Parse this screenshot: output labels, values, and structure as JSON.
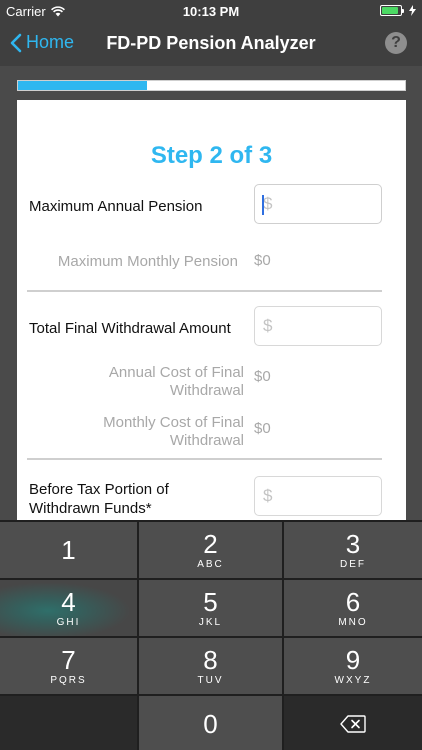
{
  "status_bar": {
    "carrier": "Carrier",
    "time": "10:13 PM",
    "battery_level": 0.9,
    "accent_color": "#4cd964"
  },
  "nav": {
    "back_label": "Home",
    "title": "FD-PD Pension Analyzer",
    "help_label": "?"
  },
  "progress": {
    "step": 2,
    "total": 3,
    "accent_color": "#2fb7f0"
  },
  "step_title": "Step 2 of 3",
  "form": {
    "max_annual_pension_label": "Maximum Annual Pension",
    "max_annual_pension_placeholder": "$",
    "max_monthly_pension_label": "Maximum Monthly Pension",
    "max_monthly_pension_value": "$0",
    "total_final_withdrawal_label": "Total Final Withdrawal Amount",
    "total_final_withdrawal_placeholder": "$",
    "annual_cost_label_line1": "Annual Cost of Final",
    "annual_cost_label_line2": "Withdrawal",
    "annual_cost_value": "$0",
    "monthly_cost_label_line1": "Monthly Cost of Final",
    "monthly_cost_label_line2": "Withdrawal",
    "monthly_cost_value": "$0",
    "before_tax_label_line1": "Before Tax Portion of",
    "before_tax_label_line2": "Withdrawn Funds*",
    "before_tax_placeholder": "$"
  },
  "keyboard": {
    "keys": [
      {
        "num": "1",
        "letters": ""
      },
      {
        "num": "2",
        "letters": "ABC"
      },
      {
        "num": "3",
        "letters": "DEF"
      },
      {
        "num": "4",
        "letters": "GHI"
      },
      {
        "num": "5",
        "letters": "JKL"
      },
      {
        "num": "6",
        "letters": "MNO"
      },
      {
        "num": "7",
        "letters": "PQRS"
      },
      {
        "num": "8",
        "letters": "TUV"
      },
      {
        "num": "9",
        "letters": "WXYZ"
      },
      {
        "num": "0",
        "letters": ""
      }
    ],
    "delete_icon": "backspace-icon"
  }
}
